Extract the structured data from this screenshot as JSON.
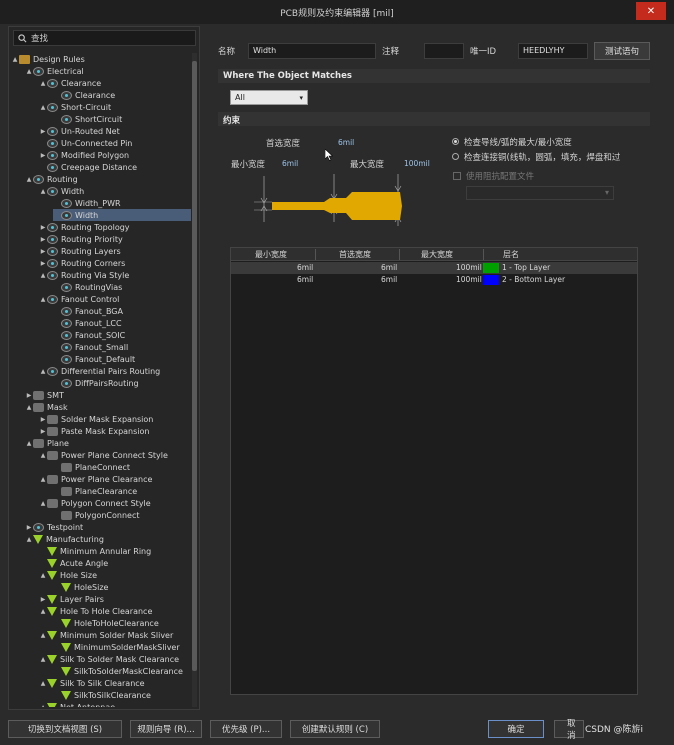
{
  "window": {
    "title": "PCB规则及约束编辑器 [mil]",
    "close_glyph": "✕"
  },
  "search": {
    "placeholder": "查找"
  },
  "tree": [
    {
      "label": "Design Rules",
      "level": 0,
      "arrow": "▲",
      "icon": "folder"
    },
    {
      "label": "Electrical",
      "level": 1,
      "arrow": "▲",
      "icon": "rule"
    },
    {
      "label": "Clearance",
      "level": 2,
      "arrow": "▲",
      "icon": "rule"
    },
    {
      "label": "Clearance",
      "level": 3,
      "arrow": "",
      "icon": "rule"
    },
    {
      "label": "Short-Circuit",
      "level": 2,
      "arrow": "▲",
      "icon": "rule"
    },
    {
      "label": "ShortCircuit",
      "level": 3,
      "arrow": "",
      "icon": "rule"
    },
    {
      "label": "Un-Routed Net",
      "level": 2,
      "arrow": "▶",
      "icon": "rule"
    },
    {
      "label": "Un-Connected Pin",
      "level": 2,
      "arrow": "",
      "icon": "rule"
    },
    {
      "label": "Modified Polygon",
      "level": 2,
      "arrow": "▶",
      "icon": "rule"
    },
    {
      "label": "Creepage Distance",
      "level": 2,
      "arrow": "",
      "icon": "rule"
    },
    {
      "label": "Routing",
      "level": 1,
      "arrow": "▲",
      "icon": "rule"
    },
    {
      "label": "Width",
      "level": 2,
      "arrow": "▲",
      "icon": "rule"
    },
    {
      "label": "Width_PWR",
      "level": 3,
      "arrow": "",
      "icon": "rule"
    },
    {
      "label": "Width",
      "level": 3,
      "arrow": "",
      "icon": "rule",
      "selected": true
    },
    {
      "label": "Routing Topology",
      "level": 2,
      "arrow": "▶",
      "icon": "rule"
    },
    {
      "label": "Routing Priority",
      "level": 2,
      "arrow": "▶",
      "icon": "rule"
    },
    {
      "label": "Routing Layers",
      "level": 2,
      "arrow": "▶",
      "icon": "rule"
    },
    {
      "label": "Routing Corners",
      "level": 2,
      "arrow": "▶",
      "icon": "rule"
    },
    {
      "label": "Routing Via Style",
      "level": 2,
      "arrow": "▲",
      "icon": "rule"
    },
    {
      "label": "RoutingVias",
      "level": 3,
      "arrow": "",
      "icon": "rule"
    },
    {
      "label": "Fanout Control",
      "level": 2,
      "arrow": "▲",
      "icon": "rule"
    },
    {
      "label": "Fanout_BGA",
      "level": 3,
      "arrow": "",
      "icon": "rule"
    },
    {
      "label": "Fanout_LCC",
      "level": 3,
      "arrow": "",
      "icon": "rule"
    },
    {
      "label": "Fanout_SOIC",
      "level": 3,
      "arrow": "",
      "icon": "rule"
    },
    {
      "label": "Fanout_Small",
      "level": 3,
      "arrow": "",
      "icon": "rule"
    },
    {
      "label": "Fanout_Default",
      "level": 3,
      "arrow": "",
      "icon": "rule"
    },
    {
      "label": "Differential Pairs Routing",
      "level": 2,
      "arrow": "▲",
      "icon": "rule"
    },
    {
      "label": "DiffPairsRouting",
      "level": 3,
      "arrow": "",
      "icon": "rule"
    },
    {
      "label": "SMT",
      "level": 1,
      "arrow": "▶",
      "icon": "gray"
    },
    {
      "label": "Mask",
      "level": 1,
      "arrow": "▲",
      "icon": "gray"
    },
    {
      "label": "Solder Mask Expansion",
      "level": 2,
      "arrow": "▶",
      "icon": "gray"
    },
    {
      "label": "Paste Mask Expansion",
      "level": 2,
      "arrow": "▶",
      "icon": "gray"
    },
    {
      "label": "Plane",
      "level": 1,
      "arrow": "▲",
      "icon": "gray"
    },
    {
      "label": "Power Plane Connect Style",
      "level": 2,
      "arrow": "▲",
      "icon": "gray"
    },
    {
      "label": "PlaneConnect",
      "level": 3,
      "arrow": "",
      "icon": "gray"
    },
    {
      "label": "Power Plane Clearance",
      "level": 2,
      "arrow": "▲",
      "icon": "gray"
    },
    {
      "label": "PlaneClearance",
      "level": 3,
      "arrow": "",
      "icon": "gray"
    },
    {
      "label": "Polygon Connect Style",
      "level": 2,
      "arrow": "▲",
      "icon": "gray"
    },
    {
      "label": "PolygonConnect",
      "level": 3,
      "arrow": "",
      "icon": "gray"
    },
    {
      "label": "Testpoint",
      "level": 1,
      "arrow": "▶",
      "icon": "rule"
    },
    {
      "label": "Manufacturing",
      "level": 1,
      "arrow": "▲",
      "icon": "green"
    },
    {
      "label": "Minimum Annular Ring",
      "level": 2,
      "arrow": "",
      "icon": "green"
    },
    {
      "label": "Acute Angle",
      "level": 2,
      "arrow": "",
      "icon": "green"
    },
    {
      "label": "Hole Size",
      "level": 2,
      "arrow": "▲",
      "icon": "green"
    },
    {
      "label": "HoleSize",
      "level": 3,
      "arrow": "",
      "icon": "green"
    },
    {
      "label": "Layer Pairs",
      "level": 2,
      "arrow": "▶",
      "icon": "green"
    },
    {
      "label": "Hole To Hole Clearance",
      "level": 2,
      "arrow": "▲",
      "icon": "green"
    },
    {
      "label": "HoleToHoleClearance",
      "level": 3,
      "arrow": "",
      "icon": "green"
    },
    {
      "label": "Minimum Solder Mask Sliver",
      "level": 2,
      "arrow": "▲",
      "icon": "green"
    },
    {
      "label": "MinimumSolderMaskSliver",
      "level": 3,
      "arrow": "",
      "icon": "green"
    },
    {
      "label": "Silk To Solder Mask Clearance",
      "level": 2,
      "arrow": "▲",
      "icon": "green"
    },
    {
      "label": "SilkToSolderMaskClearance",
      "level": 3,
      "arrow": "",
      "icon": "green"
    },
    {
      "label": "Silk To Silk Clearance",
      "level": 2,
      "arrow": "▲",
      "icon": "green"
    },
    {
      "label": "SilkToSilkClearance",
      "level": 3,
      "arrow": "",
      "icon": "green"
    },
    {
      "label": "Net Antennae",
      "level": 2,
      "arrow": "▲",
      "icon": "green"
    }
  ],
  "header": {
    "name_label": "名称",
    "name_value": "Width",
    "comment_label": "注释",
    "comment_value": "",
    "uid_label": "唯一ID",
    "uid_value": "HEEDLYHY",
    "test_button": "测试语句"
  },
  "where": {
    "title": "Where The Object Matches",
    "scope": "All",
    "chevron": "▾"
  },
  "constraints": {
    "title": "约束",
    "preferred_label": "首选宽度",
    "preferred_value": "6mil",
    "min_label": "最小宽度",
    "min_value": "6mil",
    "max_label": "最大宽度",
    "max_value": "100mil",
    "radio1": "检查导线/弧的最大/最小宽度",
    "radio2": "检查连接铜(线轨，圆弧，填充，焊盘和过",
    "impedance_label": "使用阻抗配置文件",
    "impedance_chevron": "▾"
  },
  "table": {
    "headers": [
      "最小宽度",
      "首选宽度",
      "最大宽度",
      "层名"
    ],
    "rows": [
      {
        "min": "6mil",
        "preferred": "6mil",
        "max": "100mil",
        "color": "#00a000",
        "layer": "1 - Top Layer"
      },
      {
        "min": "6mil",
        "preferred": "6mil",
        "max": "100mil",
        "color": "#0000ff",
        "layer": "2 - Bottom Layer"
      }
    ]
  },
  "footer": {
    "doc_view": "切换到文档视图 (S)",
    "wizard": "规则向导 (R)...",
    "priority": "优先级 (P)...",
    "default_rules": "创建默认规则 (C)",
    "ok": "确定",
    "cancel": "取消",
    "watermark": "CSDN @陈旂i"
  },
  "colors": {
    "accent_select": "#4a5d78",
    "trace": "#e0a800"
  }
}
